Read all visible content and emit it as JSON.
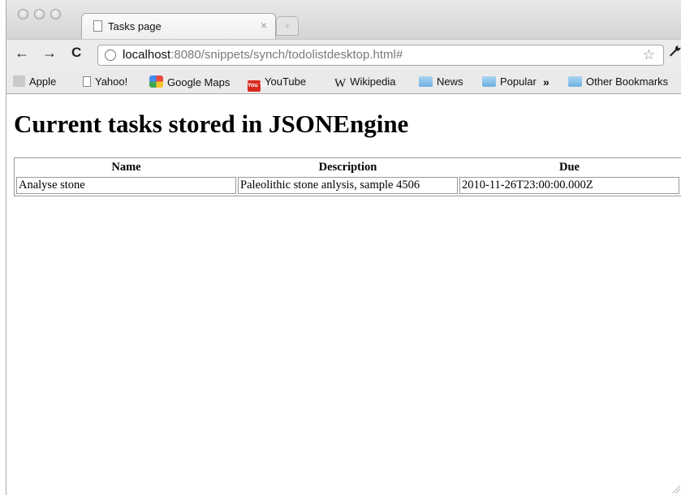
{
  "browser": {
    "tab_title": "Tasks page",
    "tab_close": "×",
    "new_tab": "+",
    "url_host": "localhost",
    "url_rest": ":8080/snippets/synch/todolistdesktop.html#",
    "back": "←",
    "forward": "→",
    "reload": "C",
    "star": "☆",
    "wrench": "🔧"
  },
  "bookmarks": {
    "items": [
      {
        "label": "Apple",
        "icon": "apple-icon"
      },
      {
        "label": "Yahoo!",
        "icon": "page-icon"
      },
      {
        "label": "Google Maps",
        "icon": "google-maps-icon"
      },
      {
        "label": "YouTube",
        "icon": "youtube-icon"
      },
      {
        "label": "Wikipedia",
        "icon": "wikipedia-icon"
      },
      {
        "label": "News",
        "icon": "folder-icon"
      },
      {
        "label": "Popular",
        "icon": "folder-icon"
      },
      {
        "label": "Other Bookmarks",
        "icon": "folder-icon"
      }
    ],
    "overflow": "»",
    "youtube_icon_text": "You Tube",
    "wikipedia_icon_text": "W"
  },
  "page": {
    "heading": "Current tasks stored in JSONEngine",
    "table": {
      "headers": [
        "Name",
        "Description",
        "Due"
      ],
      "rows": [
        [
          "Analyse stone",
          "Paleolithic stone anlysis, sample 4506",
          "2010-11-26T23:00:00.000Z"
        ]
      ]
    }
  }
}
